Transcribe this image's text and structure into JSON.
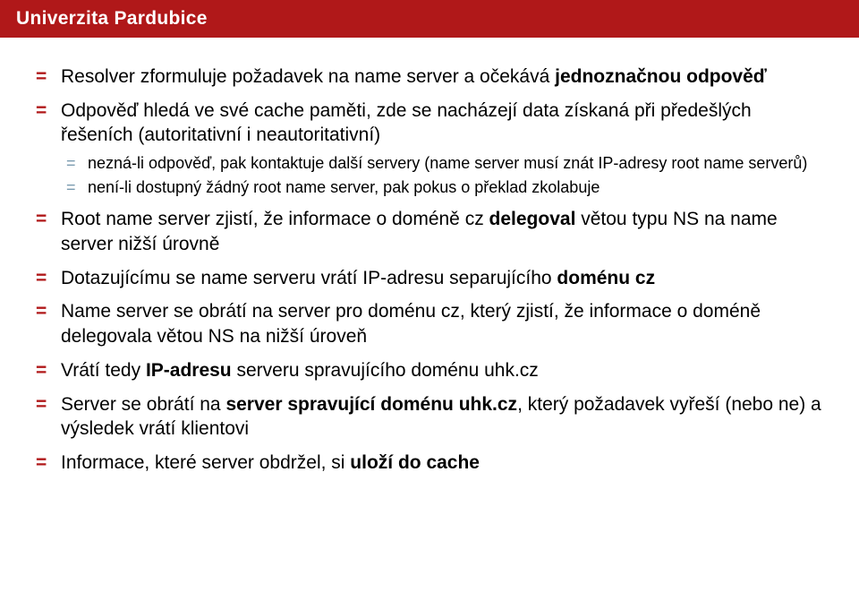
{
  "header": {
    "brand": "Univerzita Pardubice"
  },
  "items": [
    {
      "text": "Resolver zformuluje požadavek na name server a očekává ",
      "bold1": "jednoznačnou odpověď",
      "sub": []
    },
    {
      "text": "Odpověď hledá ve své cache paměti, zde se nacházejí data získaná při předešlých řešeních (autoritativní i neautoritativní)",
      "sub": [
        {
          "text": "nezná-li odpověď, pak kontaktuje další servery (name server musí znát IP-adresy root name serverů)"
        },
        {
          "text": "není-li dostupný žádný root name server, pak pokus o překlad zkolabuje"
        }
      ]
    },
    {
      "pre": "Root name server zjistí, že informace o doméně cz ",
      "bold": "delegoval",
      "post": " větou typu NS na name server nižší úrovně",
      "sub": []
    },
    {
      "pre": "Dotazujícímu se name serveru vrátí IP-adresu separujícího ",
      "bold": "doménu cz",
      "sub": []
    },
    {
      "text": "Name server se obrátí na server pro doménu cz, který zjistí, že informace o doméně delegovala větou NS na nižší úroveň",
      "sub": []
    },
    {
      "pre": "Vrátí tedy ",
      "bold": "IP-adresu",
      "post": " serveru spravujícího doménu uhk.cz",
      "sub": []
    },
    {
      "pre": "Server se obrátí na ",
      "bold": "server spravující doménu uhk.cz",
      "post": ", který požadavek vyřeší (nebo ne) a výsledek vrátí klientovi",
      "sub": []
    },
    {
      "pre": "Informace, které server obdržel, si ",
      "bold": "uloží do cache",
      "sub": []
    }
  ]
}
